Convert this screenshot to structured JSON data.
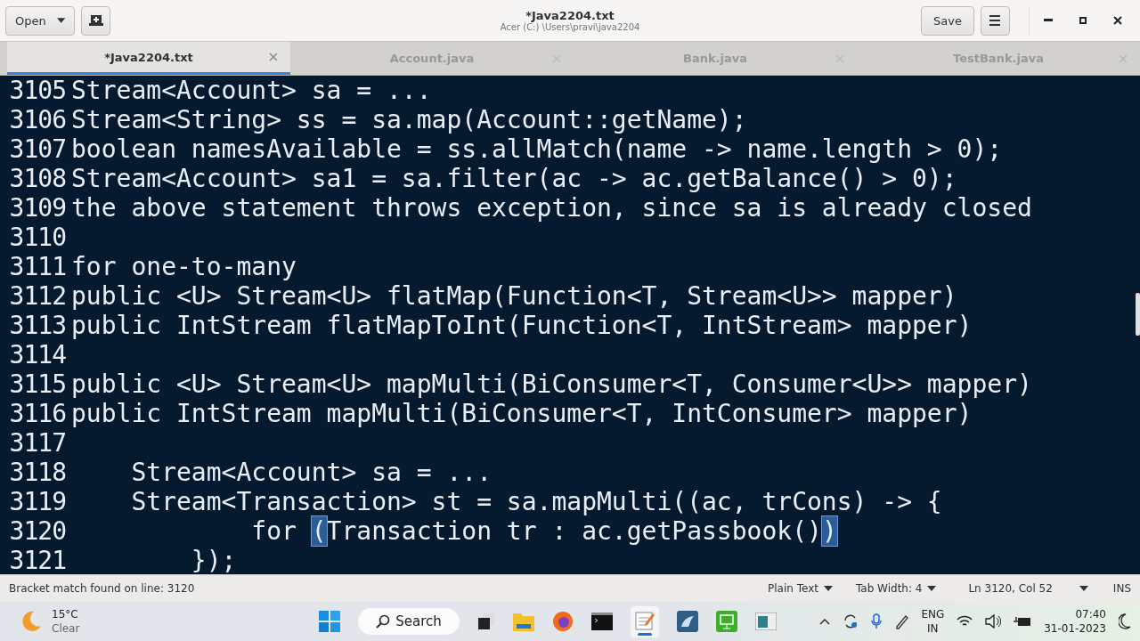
{
  "header": {
    "open_label": "Open",
    "title": "*Java2204.txt",
    "subtitle": "Acer (C:) \\Users\\pravi\\java2204",
    "save_label": "Save"
  },
  "tabs": [
    {
      "label": "*Java2204.txt",
      "selected": true
    },
    {
      "label": "Account.java",
      "selected": false
    },
    {
      "label": "Bank.java",
      "selected": false
    },
    {
      "label": "TestBank.java",
      "selected": false
    }
  ],
  "lines": [
    {
      "number": "3105",
      "segments": [
        {
          "text": "Stream<Account> sa = ...",
          "bracket_match": false
        }
      ]
    },
    {
      "number": "3106",
      "segments": [
        {
          "text": "Stream<String> ss = sa.map(Account::getName);",
          "bracket_match": false
        }
      ]
    },
    {
      "number": "3107",
      "segments": [
        {
          "text": "boolean namesAvailable = ss.allMatch(name -> name.length > 0);",
          "bracket_match": false
        }
      ]
    },
    {
      "number": "3108",
      "segments": [
        {
          "text": "Stream<Account> sa1 = sa.filter(ac -> ac.getBalance() > 0);",
          "bracket_match": false
        }
      ]
    },
    {
      "number": "3109",
      "segments": [
        {
          "text": "the above statement throws exception, since sa is already closed",
          "bracket_match": false
        }
      ]
    },
    {
      "number": "3110"
    },
    {
      "number": "3111",
      "segments": [
        {
          "text": "for one-to-many",
          "bracket_match": false
        }
      ]
    },
    {
      "number": "3112",
      "segments": [
        {
          "text": "public <U> Stream<U> flatMap(Function<T, Stream<U>> mapper)",
          "bracket_match": false
        }
      ]
    },
    {
      "number": "3113",
      "segments": [
        {
          "text": "public IntStream flatMapToInt(Function<T, IntStream> mapper)",
          "bracket_match": false
        }
      ]
    },
    {
      "number": "3114"
    },
    {
      "number": "3115",
      "segments": [
        {
          "text": "public <U> Stream<U> mapMulti(BiConsumer<T, Consumer<U>> mapper)",
          "bracket_match": false
        }
      ]
    },
    {
      "number": "3116",
      "segments": [
        {
          "text": "public IntStream mapMulti(BiConsumer<T, IntConsumer> mapper)",
          "bracket_match": false
        }
      ]
    },
    {
      "number": "3117"
    },
    {
      "number": "3118",
      "segments": [
        {
          "text": "    Stream<Account> sa = ...",
          "bracket_match": false
        }
      ]
    },
    {
      "number": "3119",
      "segments": [
        {
          "text": "    Stream<Transaction> st = sa.mapMulti((ac, trCons) -> {",
          "bracket_match": false
        }
      ]
    },
    {
      "number": "3120",
      "segments": [
        {
          "text": "            for ",
          "bracket_match": false
        },
        {
          "text": "(",
          "bracket_match": true
        },
        {
          "text": "Transaction tr : ac.getPassbook()",
          "bracket_match": false
        },
        {
          "text": ")",
          "bracket_match": true
        }
      ]
    },
    {
      "number": "3121",
      "segments": [
        {
          "text": "        });",
          "bracket_match": false
        }
      ]
    }
  ],
  "status_bar": {
    "message": "Bracket match found on line: 3120",
    "language": "Plain Text",
    "tab_width": "Tab Width: 4",
    "position": "Ln 3120, Col 52",
    "mode": "INS"
  },
  "taskbar": {
    "temperature": "15°C",
    "weather": "Clear",
    "search": "Search",
    "language": "ENG",
    "region": "IN",
    "time": "07:40",
    "date": "31-01-2023"
  }
}
